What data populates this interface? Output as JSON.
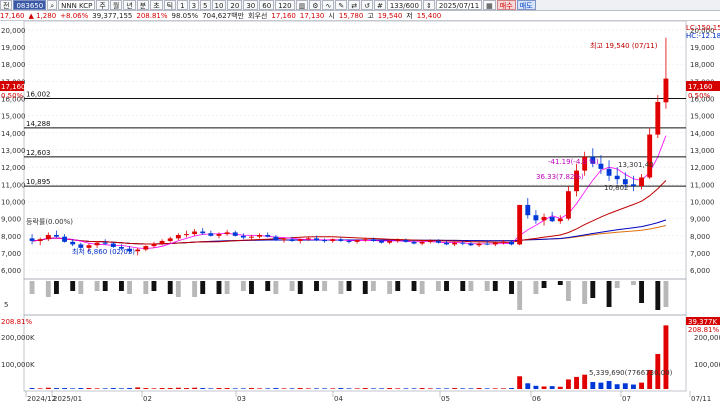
{
  "toolbar": {
    "exchange_label": "전",
    "stock_code": "083650",
    "stock_name": "NNN KCP",
    "period_buttons": [
      "주",
      "월",
      "년",
      "분",
      "초",
      "틱"
    ],
    "interval_buttons": [
      "1",
      "3",
      "5",
      "10",
      "20",
      "30",
      "60",
      "120"
    ],
    "count_value": "133/600",
    "date_value": "2025/07/11",
    "buy_label": "매수",
    "sell_label": "매도"
  },
  "quote": {
    "price": "17,160",
    "change": "▲ 1,280",
    "change_pct": "+8.06%",
    "volume": "39,377,155",
    "volume_ratio": "208.81%",
    "strength": "98.05%",
    "trade_value": "704,627백만",
    "weighted_label": "회우선",
    "weighted_value": "17,160",
    "open_value": "17,130",
    "open_label": "시",
    "open_price": "15,780",
    "high_label": "고",
    "high_price": "19,540",
    "low_label": "저",
    "low_price": "15,400"
  },
  "colors": {
    "up": "#e00000",
    "down": "#0038d8",
    "ma5": "#ff00ff",
    "ma20": "#c00000",
    "ma60": "#0000c0",
    "ma120": "#e07010"
  },
  "chart_data": {
    "type": "candlestick",
    "x_tick_labels": [
      "2024/12",
      "2025/01",
      "02",
      "03",
      "04",
      "05",
      "06",
      "07",
      "07/11"
    ],
    "y_tick_labels": [
      "20,000",
      "19,000",
      "18,000",
      "17,000",
      "16,000",
      "15,000",
      "14,000",
      "13,000",
      "12,000",
      "11,000",
      "10,000",
      "9,000",
      "8,000",
      "7,000",
      "6,000"
    ],
    "ylim": [
      5600,
      20400
    ],
    "current_price_label": "17,160",
    "current_pct_label": "0.50%",
    "hline_levels": [
      16002,
      14288,
      12603,
      10895
    ],
    "hline_labels": [
      "16,002",
      "14,288",
      "12,603",
      "10,895"
    ],
    "annotations": {
      "high_text": "최고 19,540 (07/11)",
      "low_text": "최저 6,860 (02/03)",
      "peak_lc": "LC:150.15",
      "peak_hc": "HC:-12.18",
      "pct_left": "등락률(0.00%)",
      "pct_a": "-41.19(-4.0 %)",
      "pct_b": "36.33(7.82%)",
      "price_a": "13,301,40",
      "price_b": "10,802"
    },
    "candles": [
      [
        7850,
        8100,
        7500,
        7700
      ],
      [
        7700,
        7900,
        7450,
        7800
      ],
      [
        7800,
        8200,
        7700,
        8050
      ],
      [
        8050,
        8300,
        7900,
        7950
      ],
      [
        7950,
        8100,
        7600,
        7650
      ],
      [
        7650,
        7800,
        7400,
        7500
      ],
      [
        7500,
        7600,
        7200,
        7300
      ],
      [
        7300,
        7550,
        7100,
        7450
      ],
      [
        7450,
        7700,
        7300,
        7600
      ],
      [
        7600,
        7800,
        7450,
        7550
      ],
      [
        7550,
        7650,
        7300,
        7350
      ],
      [
        7350,
        7500,
        7150,
        7250
      ],
      [
        7250,
        7400,
        7000,
        7100
      ],
      [
        7100,
        7300,
        6860,
        7200
      ],
      [
        7200,
        7450,
        7100,
        7400
      ],
      [
        7400,
        7650,
        7300,
        7550
      ],
      [
        7550,
        7800,
        7450,
        7700
      ],
      [
        7700,
        7950,
        7600,
        7850
      ],
      [
        7850,
        8150,
        7750,
        8050
      ],
      [
        8050,
        8300,
        7900,
        8100
      ],
      [
        8100,
        8400,
        8000,
        8250
      ],
      [
        8250,
        8450,
        8050,
        8150
      ],
      [
        8150,
        8300,
        7950,
        8000
      ],
      [
        8000,
        8200,
        7850,
        8100
      ],
      [
        8100,
        8350,
        8000,
        8200
      ],
      [
        8200,
        8300,
        7950,
        8000
      ],
      [
        8000,
        8150,
        7800,
        7900
      ],
      [
        7900,
        8050,
        7750,
        7950
      ],
      [
        7950,
        8150,
        7850,
        8050
      ],
      [
        8050,
        8200,
        7900,
        7950
      ],
      [
        7950,
        8050,
        7700,
        7750
      ],
      [
        7750,
        7900,
        7600,
        7800
      ],
      [
        7800,
        7950,
        7650,
        7700
      ],
      [
        7700,
        7850,
        7550,
        7800
      ],
      [
        7800,
        7950,
        7700,
        7850
      ],
      [
        7850,
        8000,
        7700,
        7750
      ],
      [
        7750,
        7850,
        7600,
        7700
      ],
      [
        7700,
        7850,
        7600,
        7800
      ],
      [
        7800,
        7900,
        7650,
        7700
      ],
      [
        7700,
        7800,
        7550,
        7650
      ],
      [
        7650,
        7800,
        7550,
        7750
      ],
      [
        7750,
        7900,
        7650,
        7800
      ],
      [
        7800,
        7900,
        7650,
        7700
      ],
      [
        7700,
        7800,
        7550,
        7600
      ],
      [
        7600,
        7750,
        7500,
        7700
      ],
      [
        7700,
        7850,
        7600,
        7750
      ],
      [
        7750,
        7850,
        7600,
        7650
      ],
      [
        7650,
        7750,
        7500,
        7550
      ],
      [
        7550,
        7700,
        7450,
        7650
      ],
      [
        7650,
        7800,
        7550,
        7700
      ],
      [
        7700,
        7800,
        7550,
        7600
      ],
      [
        7600,
        7700,
        7450,
        7500
      ],
      [
        7500,
        7650,
        7400,
        7600
      ],
      [
        7600,
        7700,
        7450,
        7550
      ],
      [
        7550,
        7650,
        7400,
        7450
      ],
      [
        7450,
        7600,
        7350,
        7550
      ],
      [
        7550,
        7700,
        7450,
        7500
      ],
      [
        7500,
        7650,
        7400,
        7600
      ],
      [
        7600,
        7750,
        7500,
        7650
      ],
      [
        7650,
        7700,
        7450,
        7500
      ],
      [
        7500,
        8600,
        7450,
        9800
      ],
      [
        9800,
        10200,
        9000,
        9200
      ],
      [
        9200,
        9500,
        8700,
        8900
      ],
      [
        8900,
        9300,
        8600,
        9100
      ],
      [
        9100,
        9400,
        8800,
        8850
      ],
      [
        8850,
        9200,
        8700,
        9000
      ],
      [
        9000,
        10900,
        8900,
        10600
      ],
      [
        10600,
        12200,
        10300,
        11800
      ],
      [
        11800,
        12900,
        11500,
        12600
      ],
      [
        12600,
        13100,
        12000,
        12200
      ],
      [
        12200,
        12700,
        11600,
        11900
      ],
      [
        11900,
        12400,
        11200,
        11500
      ],
      [
        11500,
        12000,
        11000,
        11300
      ],
      [
        11300,
        11700,
        10800,
        11000
      ],
      [
        11000,
        11500,
        10600,
        10900
      ],
      [
        10900,
        11600,
        10700,
        11400
      ],
      [
        11400,
        14300,
        11300,
        13900
      ],
      [
        13900,
        16200,
        13700,
        15800
      ],
      [
        15780,
        19540,
        15400,
        17160
      ]
    ],
    "volume_axis_labels": [
      "200,000K",
      "100,000K"
    ],
    "volume_current_label": "39,377K",
    "volume_pct_label": "208.81%",
    "volume_annotation": "5,339,690(7766730,00)",
    "volume_values": [
      3,
      2,
      4,
      3,
      3,
      2,
      3,
      3,
      2,
      2,
      3,
      2,
      3,
      5,
      3,
      2,
      3,
      3,
      4,
      3,
      4,
      3,
      2,
      3,
      3,
      2,
      2,
      3,
      2,
      2,
      3,
      2,
      2,
      3,
      2,
      2,
      2,
      2,
      3,
      2,
      2,
      3,
      2,
      2,
      3,
      2,
      2,
      2,
      3,
      2,
      2,
      2,
      3,
      2,
      2,
      3,
      2,
      2,
      2,
      3,
      40,
      18,
      10,
      8,
      9,
      7,
      30,
      38,
      45,
      22,
      20,
      25,
      15,
      18,
      14,
      20,
      60,
      110,
      200
    ],
    "oscillator_label": "5"
  }
}
